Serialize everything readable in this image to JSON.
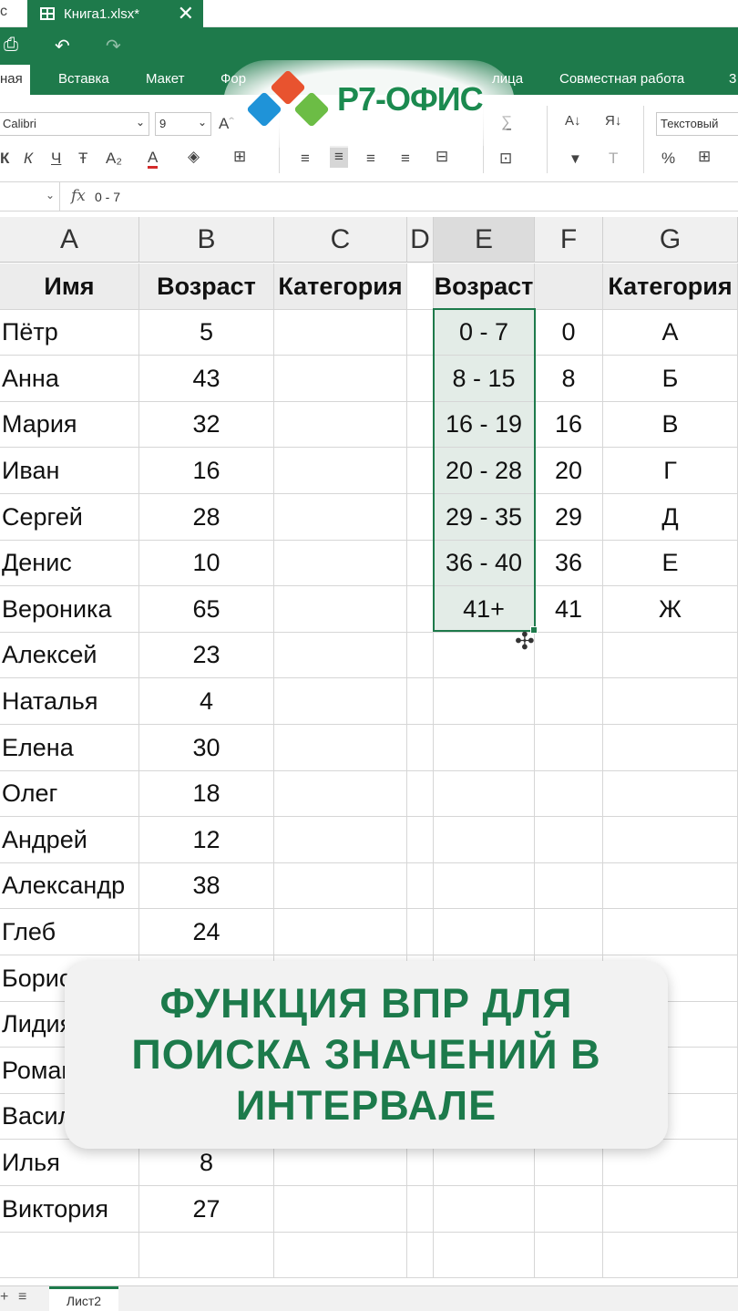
{
  "titlebar": {
    "left_fragment": "с",
    "doc_name": "Книга1.xlsx*",
    "close": "✕"
  },
  "ribbon": {
    "tabs": [
      "ная",
      "Вставка",
      "Макет",
      "Фор",
      "лица",
      "Совместная работа",
      "3"
    ]
  },
  "toolbar": {
    "font_name": "Calibri",
    "font_size": "9",
    "number_format": "Текстовый",
    "bold": "К",
    "italic": "К",
    "underline": "Ч",
    "strike": "Ŧ",
    "subscript": "A₂",
    "font_color": "A",
    "sum": "∑",
    "percent": "%",
    "sort_asc": "А↓",
    "sort_desc": "Я↓",
    "filter": "▼",
    "clear_filter": "T"
  },
  "formula_bar": {
    "fx": "fx",
    "value": "0 - 7"
  },
  "columns": [
    "A",
    "B",
    "C",
    "D",
    "E",
    "F",
    "G"
  ],
  "table1": {
    "headers": [
      "Имя",
      "Возраст",
      "Категория"
    ],
    "rows": [
      [
        "Пётр",
        "5"
      ],
      [
        "Анна",
        "43"
      ],
      [
        "Мария",
        "32"
      ],
      [
        "Иван",
        "16"
      ],
      [
        "Сергей",
        "28"
      ],
      [
        "Денис",
        "10"
      ],
      [
        "Вероника",
        "65"
      ],
      [
        "Алексей",
        "23"
      ],
      [
        "Наталья",
        "4"
      ],
      [
        "Елена",
        "30"
      ],
      [
        "Олег",
        "18"
      ],
      [
        "Андрей",
        "12"
      ],
      [
        "Александр",
        "38"
      ],
      [
        "Глеб",
        "24"
      ],
      [
        "Борис",
        ""
      ],
      [
        "Лидия",
        ""
      ],
      [
        "Роман",
        ""
      ],
      [
        "Василий",
        ""
      ],
      [
        "Илья",
        "8"
      ],
      [
        "Виктория",
        "27"
      ]
    ]
  },
  "table2": {
    "headers": [
      "Возраст",
      "",
      "Категория"
    ],
    "rows": [
      [
        "0 - 7",
        "0",
        "А"
      ],
      [
        "8 - 15",
        "8",
        "Б"
      ],
      [
        "16 - 19",
        "16",
        "В"
      ],
      [
        "20 - 28",
        "20",
        "Г"
      ],
      [
        "29 - 35",
        "29",
        "Д"
      ],
      [
        "36 - 40",
        "36",
        "Е"
      ],
      [
        "41+",
        "41",
        "Ж"
      ]
    ]
  },
  "logo": {
    "text": "Р7-ОФИС",
    "colors": [
      "#e8532f",
      "#1f93d8",
      "#6cbd45"
    ]
  },
  "sheets": {
    "active": "Лист2"
  },
  "overlay": {
    "lines": [
      "ФУНКЦИЯ ВПР ДЛЯ",
      "ПОИСКА ЗНАЧЕНИЙ В",
      "ИНТЕРВАЛЕ"
    ]
  },
  "accent": "#1e7a4b"
}
